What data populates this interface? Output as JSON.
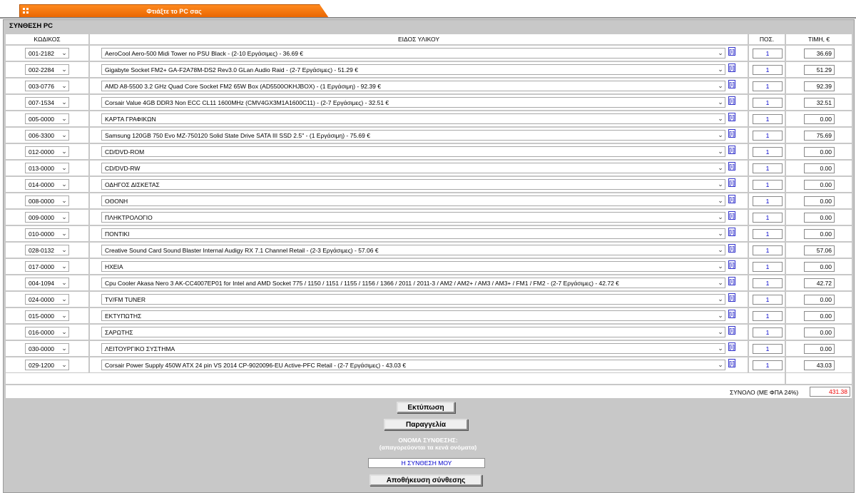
{
  "tab": {
    "label": "Φτιάξτε το PC σας"
  },
  "panel": {
    "title": "ΣΥΝΘΕΣΗ PC"
  },
  "headers": {
    "code": "ΚΩΔΙΚΟΣ",
    "item": "ΕΙΔΟΣ ΥΛΙΚΟΥ",
    "qty": "ΠΟΣ.",
    "price": "ΤΙΜΗ, €"
  },
  "info_label": "[i]",
  "rows": [
    {
      "code": "001-2182",
      "item": "AeroCool Aero-500 Midi Tower no PSU Black - (2-10 Εργάσιμες) - 36.69 €",
      "qty": "1",
      "price": "36.69"
    },
    {
      "code": "002-2284",
      "item": "Gigabyte Socket FM2+ GA-F2A78M-DS2 Rev3.0 GLan Audio Raid - (2-7 Εργάσιμες) - 51.29 €",
      "qty": "1",
      "price": "51.29"
    },
    {
      "code": "003-0776",
      "item": "AMD A8-5500 3.2 GHz Quad Core Socket FM2 65W Box (AD5500OKHJBOX) - (1 Εργάσιμη) - 92.39 €",
      "qty": "1",
      "price": "92.39"
    },
    {
      "code": "007-1534",
      "item": "Corsair Value 4GB DDR3 Non ECC CL11 1600MHz (CMV4GX3M1A1600C11) - (2-7 Εργάσιμες) - 32.51 €",
      "qty": "1",
      "price": "32.51"
    },
    {
      "code": "005-0000",
      "item": "ΚΑΡΤΑ ΓΡΑΦΙΚΩΝ",
      "qty": "1",
      "price": "0.00"
    },
    {
      "code": "006-3300",
      "item": "Samsung 120GB 750 Evo MZ-750120 Solid State Drive SATA III SSD 2.5'' - (1 Εργάσιμη) - 75.69 €",
      "qty": "1",
      "price": "75.69"
    },
    {
      "code": "012-0000",
      "item": "CD/DVD-ROM",
      "qty": "1",
      "price": "0.00"
    },
    {
      "code": "013-0000",
      "item": "CD/DVD-RW",
      "qty": "1",
      "price": "0.00"
    },
    {
      "code": "014-0000",
      "item": "ΟΔΗΓΟΣ ΔΙΣΚΕΤΑΣ",
      "qty": "1",
      "price": "0.00"
    },
    {
      "code": "008-0000",
      "item": "ΟΘΟΝΗ",
      "qty": "1",
      "price": "0.00"
    },
    {
      "code": "009-0000",
      "item": "ΠΛΗΚΤΡΟΛΟΓΙΟ",
      "qty": "1",
      "price": "0.00"
    },
    {
      "code": "010-0000",
      "item": "ΠΟΝΤΙΚΙ",
      "qty": "1",
      "price": "0.00"
    },
    {
      "code": "028-0132",
      "item": "Creative Sound Card Sound Blaster Internal Audigy RX 7.1 Channel Retail - (2-3 Εργάσιμες) - 57.06 €",
      "qty": "1",
      "price": "57.06"
    },
    {
      "code": "017-0000",
      "item": "ΗΧΕΙΑ",
      "qty": "1",
      "price": "0.00"
    },
    {
      "code": "004-1094",
      "item": "Cpu Cooler Akasa Nero 3 AK-CC4007EP01 for Intel and AMD Socket 775 / 1150 / 1151 / 1155 / 1156 / 1366 / 2011 / 2011-3 / AM2 / AM2+ / AM3 / AM3+ / FM1 / FM2 - (2-7 Εργάσιμες) - 42.72 €",
      "qty": "1",
      "price": "42.72"
    },
    {
      "code": "024-0000",
      "item": "TV/FM TUNER",
      "qty": "1",
      "price": "0.00"
    },
    {
      "code": "015-0000",
      "item": "ΕΚΤΥΠΩΤΗΣ",
      "qty": "1",
      "price": "0.00"
    },
    {
      "code": "016-0000",
      "item": "ΣΑΡΩΤΗΣ",
      "qty": "1",
      "price": "0.00"
    },
    {
      "code": "030-0000",
      "item": "ΛΕΙΤΟΥΡΓΙΚΟ ΣΥΣΤΗΜΑ",
      "qty": "1",
      "price": "0.00"
    },
    {
      "code": "029-1200",
      "item": "Corsair Power Supply 450W ATX 24 pin VS 2014 CP-9020096-EU Active-PFC Retail - (2-7 Εργάσιμες) - 43.03 €",
      "qty": "1",
      "price": "43.03"
    }
  ],
  "total": {
    "label": "ΣΥΝΟΛΟ (ΜΕ ΦΠΑ 24%)",
    "value": "431.38"
  },
  "buttons": {
    "print": "Εκτύπωση",
    "order": "Παραγγελία",
    "save": "Αποθήκευση σύνθεσης"
  },
  "config_name": {
    "label": "ΟΝΟΜΑ ΣΥΝΘΕΣΗΣ:",
    "hint": "(απαγορεύονται τα κενά ονόματα)",
    "value": "Η ΣΥΝΘΕΣΗ ΜΟΥ"
  },
  "colors": {
    "tab": "#f07810",
    "panel": "#c8c8c8",
    "total_value": "#ee0000",
    "qty_text": "#0000cc"
  }
}
